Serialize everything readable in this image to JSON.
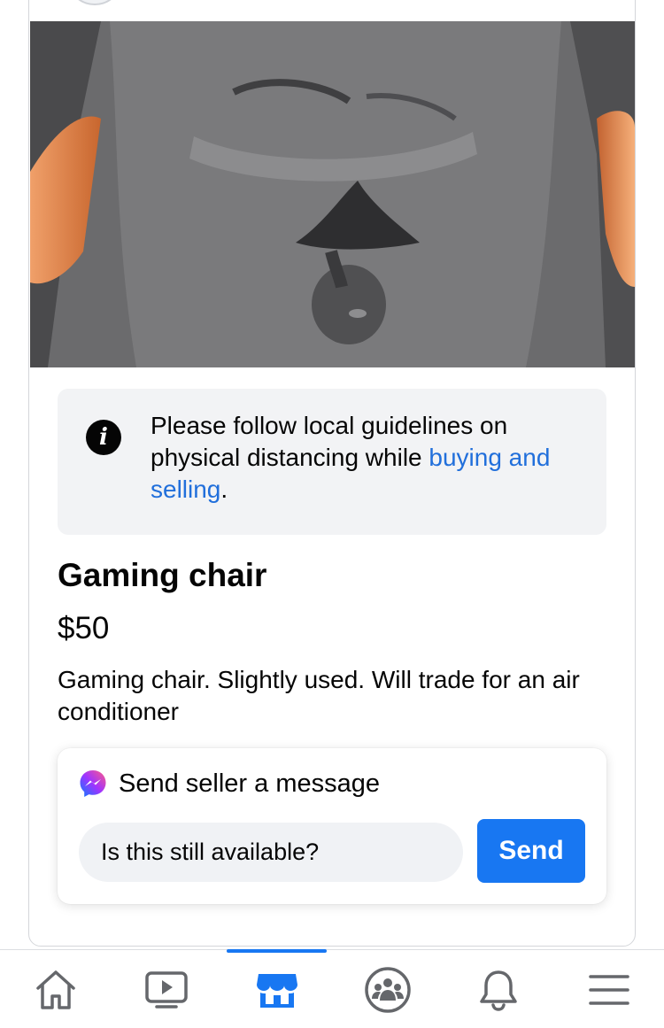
{
  "notice": {
    "text_before": "Please follow local guidelines on physical distancing while ",
    "link_text": "buying and selling",
    "text_after": "."
  },
  "listing": {
    "title": "Gaming chair",
    "price": "$50",
    "description": "Gaming chair. Slightly used. Will trade for an air conditioner"
  },
  "message": {
    "heading": "Send seller a message",
    "input_value": "Is this still available?",
    "send_label": "Send"
  },
  "tabs": [
    {
      "name": "home",
      "icon": "home-icon",
      "active": false
    },
    {
      "name": "watch",
      "icon": "video-icon",
      "active": false
    },
    {
      "name": "marketplace",
      "icon": "marketplace-icon",
      "active": true
    },
    {
      "name": "groups",
      "icon": "groups-icon",
      "active": false
    },
    {
      "name": "notifications",
      "icon": "bell-icon",
      "active": false
    },
    {
      "name": "menu",
      "icon": "menu-icon",
      "active": false
    }
  ],
  "colors": {
    "accent": "#1877f2",
    "link": "#216fdb",
    "icon_gray": "#65676b"
  }
}
